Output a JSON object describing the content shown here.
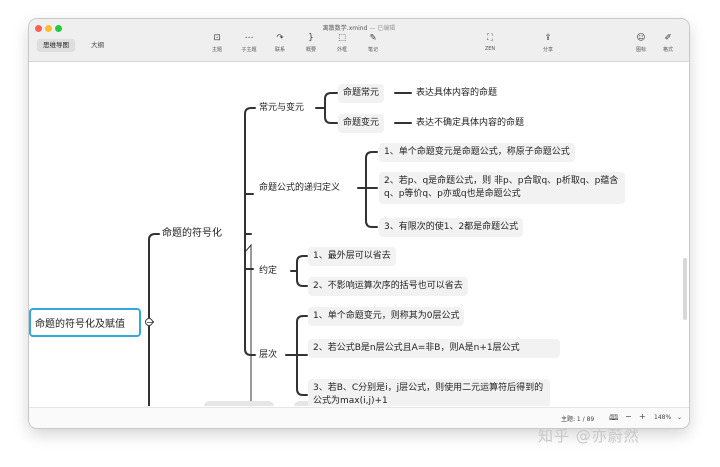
{
  "window": {
    "title": "离散数学.xmind",
    "title_suffix": "— 已编辑"
  },
  "view_tabs": [
    {
      "label": "思维导图",
      "active": true
    },
    {
      "label": "大纲",
      "active": false
    }
  ],
  "toolbar": [
    {
      "label": "主题",
      "icon": "topic-icon",
      "glyph": "⊡"
    },
    {
      "label": "子主题",
      "icon": "subtopic-icon",
      "glyph": "⋯"
    },
    {
      "label": "联系",
      "icon": "relationship-icon",
      "glyph": "↷"
    },
    {
      "label": "概要",
      "icon": "summary-icon",
      "glyph": "}"
    },
    {
      "label": "外框",
      "icon": "boundary-icon",
      "glyph": "⬚"
    },
    {
      "label": "笔记",
      "icon": "note-icon",
      "glyph": "✎"
    },
    {
      "label": "ZEN",
      "icon": "zen-mode-icon",
      "glyph": "⛶"
    },
    {
      "label": "分享",
      "icon": "share-icon",
      "glyph": "⇪"
    },
    {
      "label": "图标",
      "icon": "sticker-icon",
      "glyph": "☺"
    },
    {
      "label": "格式",
      "icon": "format-brush-icon",
      "glyph": "✐"
    }
  ],
  "mindmap": {
    "root": "命题的符号化及赋值",
    "main": "命题的符号化",
    "branches": {
      "b1": {
        "label": "常元与变元",
        "children": [
          {
            "label": "命题常元",
            "note": "表达具体内容的命题"
          },
          {
            "label": "命题变元",
            "note": "表达不确定具体内容的命题"
          }
        ]
      },
      "b2": {
        "label": "命题公式的递归定义",
        "children": [
          "1、单个命题变元是命题公式，称原子命题公式",
          "2、若p、q是命题公式，则 非p、p合取q、p析取q、p蕴含q、p等价q、p亦或q也是命题公式",
          "3、有限次的使1、2都是命题公式"
        ]
      },
      "b3": {
        "label": "约定",
        "children": [
          "1、最外层可以省去",
          "2、不影响运算次序的括号也可以省去"
        ]
      },
      "b4": {
        "label": "层次",
        "children": [
          "1、单个命题变元，则称其为0层公式",
          "2、若公式B是n层公式且A=非B，则A是n+1层公式",
          "3、若B、C分别是i，j层公式，则使用二元运算符后得到的公式为max(i,j)+1"
        ]
      }
    }
  },
  "statusbar": {
    "topic_count": "主题: 1 / 89",
    "map_icon": "map-icon",
    "zoom_out": "−",
    "zoom_in": "+",
    "zoom": "148%",
    "zoom_menu": "⌄"
  },
  "watermark": "知乎 @亦蔚然",
  "colors": {
    "connector": "#333333",
    "root_border": "#33a8dd",
    "leaf_bg": "#f2f2f2"
  }
}
